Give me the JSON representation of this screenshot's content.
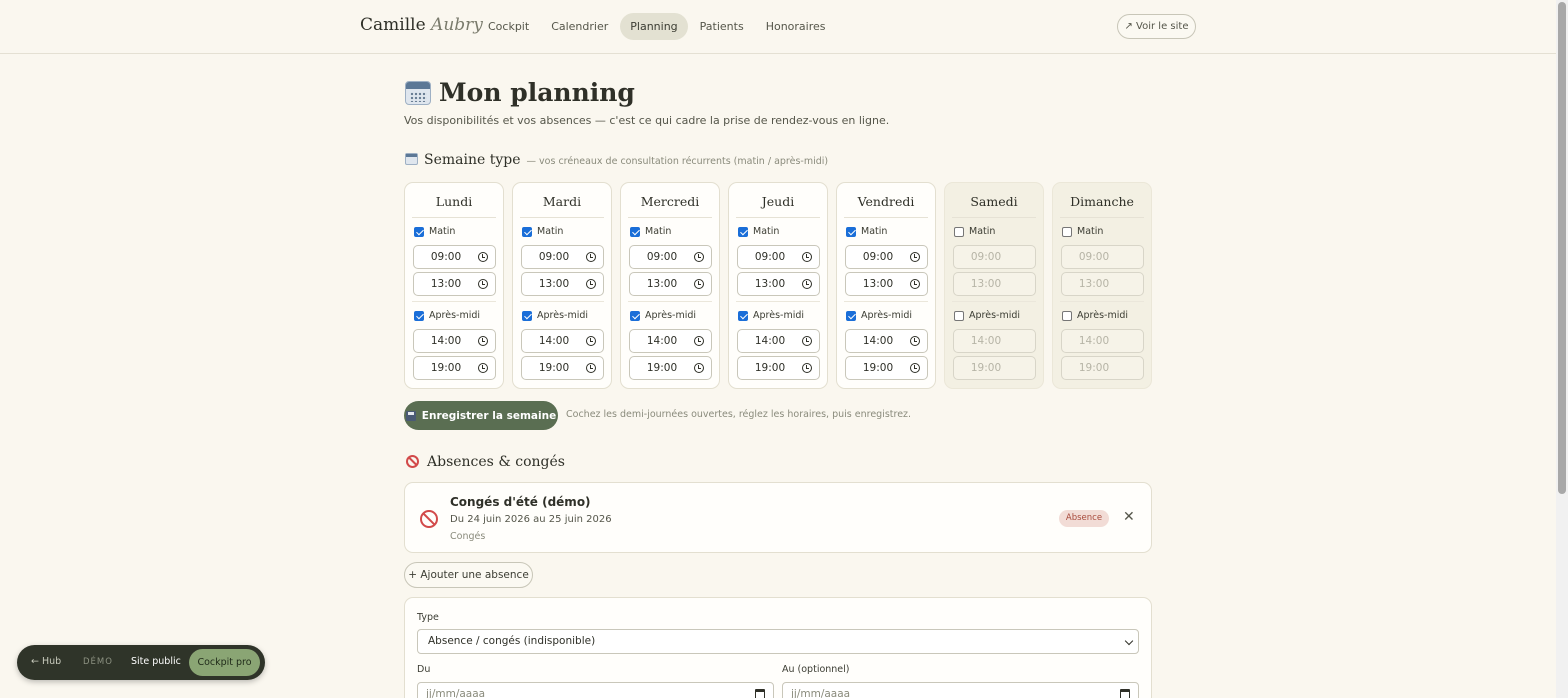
{
  "header": {
    "brand_first": "Camille",
    "brand_last": "Aubry",
    "nav": [
      {
        "label": "Cockpit"
      },
      {
        "label": "Calendrier"
      },
      {
        "label": "Planning",
        "active": true
      },
      {
        "label": "Patients"
      },
      {
        "label": "Honoraires"
      }
    ],
    "site_button": "↗ Voir le site"
  },
  "page": {
    "title": "Mon planning",
    "subtitle": "Vos disponibilités et vos absences — c'est ce qui cadre la prise de rendez-vous en ligne."
  },
  "week": {
    "title": "Semaine type",
    "hint": "— vos créneaux de consultation récurrents (matin / après-midi)",
    "morning_label": "Matin",
    "afternoon_label": "Après-midi",
    "days": [
      {
        "name": "Lundi",
        "morning": true,
        "afternoon": true,
        "m_start": "09:00",
        "m_end": "13:00",
        "a_start": "14:00",
        "a_end": "19:00"
      },
      {
        "name": "Mardi",
        "morning": true,
        "afternoon": true,
        "m_start": "09:00",
        "m_end": "13:00",
        "a_start": "14:00",
        "a_end": "19:00"
      },
      {
        "name": "Mercredi",
        "morning": true,
        "afternoon": true,
        "m_start": "09:00",
        "m_end": "13:00",
        "a_start": "14:00",
        "a_end": "19:00"
      },
      {
        "name": "Jeudi",
        "morning": true,
        "afternoon": true,
        "m_start": "09:00",
        "m_end": "13:00",
        "a_start": "14:00",
        "a_end": "19:00"
      },
      {
        "name": "Vendredi",
        "morning": true,
        "afternoon": true,
        "m_start": "09:00",
        "m_end": "13:00",
        "a_start": "14:00",
        "a_end": "19:00"
      },
      {
        "name": "Samedi",
        "morning": false,
        "afternoon": false,
        "m_start": "09:00",
        "m_end": "13:00",
        "a_start": "14:00",
        "a_end": "19:00"
      },
      {
        "name": "Dimanche",
        "morning": false,
        "afternoon": false,
        "m_start": "09:00",
        "m_end": "13:00",
        "a_start": "14:00",
        "a_end": "19:00"
      }
    ],
    "save_label": "Enregistrer la semaine",
    "save_hint": "Cochez les demi-journées ouvertes, réglez les horaires, puis enregistrez."
  },
  "absences": {
    "title": "Absences & congés",
    "items": [
      {
        "title": "Congés d'été (démo)",
        "dates": "Du 24 juin 2026 au 25 juin 2026",
        "kind": "Congés",
        "badge": "Absence",
        "close": "✕"
      }
    ],
    "add_label": "+ Ajouter une absence"
  },
  "form": {
    "type_label": "Type",
    "type_value": "Absence / congés (indisponible)",
    "from_label": "Du",
    "to_label": "Au (optionnel)",
    "date_placeholder": "jj/mm/aaaa"
  },
  "pill": {
    "hub": "← Hub",
    "demo": "DÉMO",
    "public": "Site public",
    "pro": "Cockpit pro"
  },
  "colors": {
    "background": "#faf7ef",
    "accent_green": "#5a6e52",
    "checkbox_blue": "#1a6ed8",
    "absence_red": "#d24a4a"
  }
}
